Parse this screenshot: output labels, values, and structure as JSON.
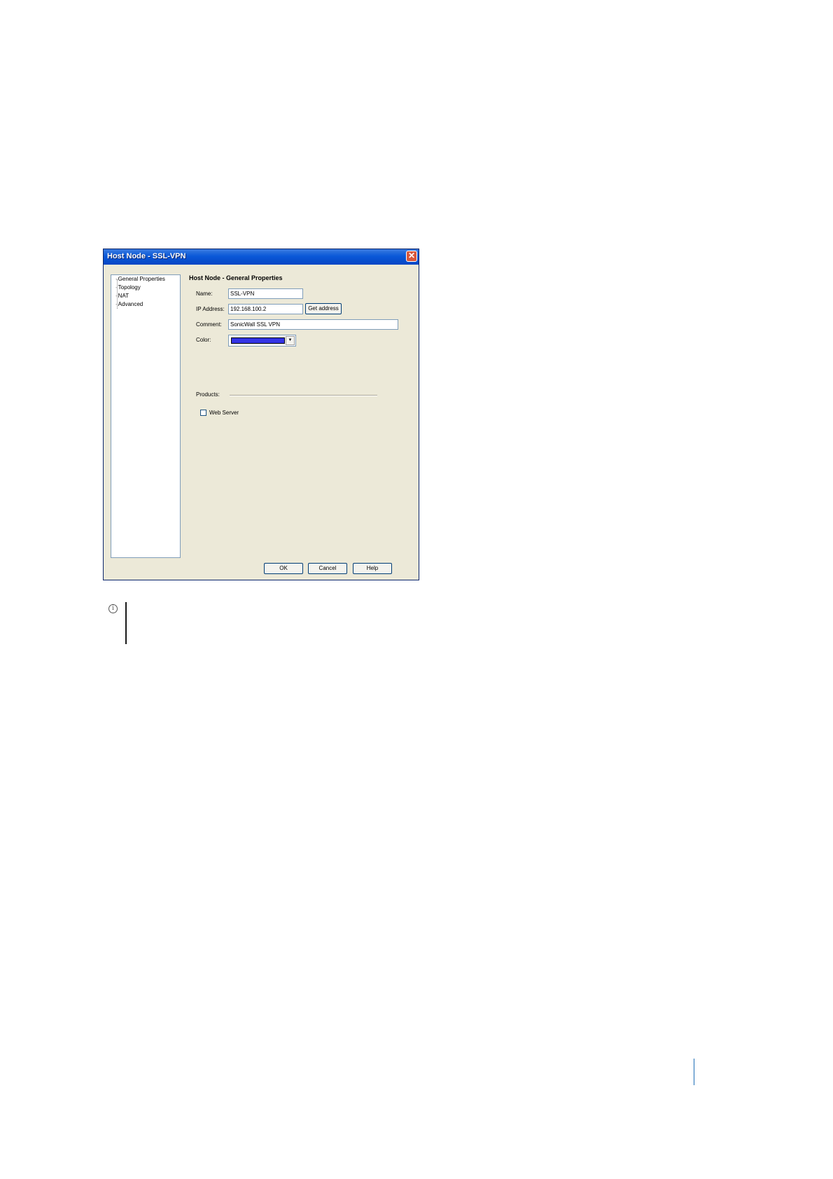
{
  "dialog": {
    "title": "Host Node - SSL-VPN",
    "close_glyph": "✕",
    "tree": {
      "items": [
        "General Properties",
        "Topology",
        "NAT",
        "Advanced"
      ]
    },
    "section_title": "Host Node - General Properties",
    "name_label": "Name:",
    "name_value": "SSL-VPN",
    "ip_label": "IP Address:",
    "ip_value": "192.168.100.2",
    "get_address_label": "Get address",
    "comment_label": "Comment:",
    "comment_value": "SonicWall SSL VPN",
    "color_label": "Color:",
    "color_value": "#3434e6",
    "dropdown_glyph": "▼",
    "products_label": "Products:",
    "web_server_label": "Web Server",
    "web_server_checked": false,
    "ok_label": "OK",
    "cancel_label": "Cancel",
    "help_label": "Help"
  },
  "note": {
    "icon": "info-icon",
    "icon_glyph": "i"
  },
  "colors": {
    "titlebar": "#0a58d8",
    "dialog_bg": "#ece9d8",
    "page_marker": "#1e6fb8"
  }
}
